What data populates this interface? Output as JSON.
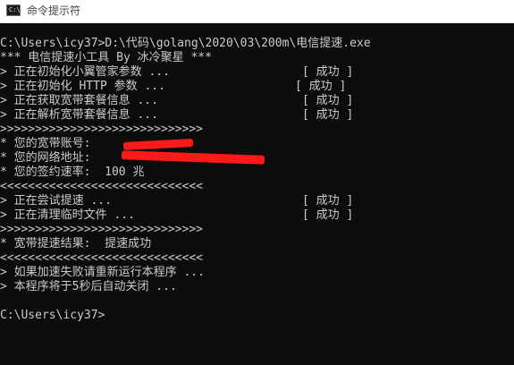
{
  "window": {
    "title": "命令提示符",
    "icon": "cmd-prompt-icon",
    "icon_glyph": "C:\\"
  },
  "console": {
    "command_line": "C:\\Users\\icy37>D:\\代码\\golang\\2020\\03\\200m\\电信提速.exe",
    "banner": "*** 电信提速小工具 By 冰冷聚星 ***",
    "init_steps": [
      {
        "text": "> 正在初始化小翼管家参数 ...",
        "status": "[ 成功 ]"
      },
      {
        "text": "> 正在初始化 HTTP 参数 ...",
        "status": "[ 成功 ]"
      },
      {
        "text": "> 正在获取宽带套餐信息 ...",
        "status": "[ 成功 ]"
      },
      {
        "text": "> 正在解析宽带套餐信息 ...",
        "status": "[ 成功 ]"
      }
    ],
    "separator_right": ">>>>>>>>>>>>>>>>>>>>>>>>>>>>>",
    "account_label": "* 您的宽带账号:",
    "ip_label": "* 您的网络地址:",
    "speed_line": "* 您的签约速率:  100 兆",
    "separator_left": "<<<<<<<<<<<<<<<<<<<<<<<<<<<<<",
    "accel_steps": [
      {
        "text": "> 正在尝试提速 ...",
        "status": "[ 成功 ]"
      },
      {
        "text": "> 正在清理临时文件 ...",
        "status": "[ 成功 ]"
      }
    ],
    "separator_right_2": ">>>>>>>>>>>>>>>>>>>>>>>>>>>>>",
    "result_line": "* 宽带提速结果:  提速成功",
    "separator_left_2": "<<<<<<<<<<<<<<<<<<<<<<<<<<<<<",
    "hint_retry": "> 如果加速失败请重新运行本程序 ...",
    "hint_close": "> 本程序将于5秒后自动关闭 ...",
    "prompt": "C:\\Users\\icy37>"
  },
  "colors": {
    "console_bg": "#0c0c0c",
    "console_text": "#cccccc",
    "redaction": "#ff1a1a"
  }
}
